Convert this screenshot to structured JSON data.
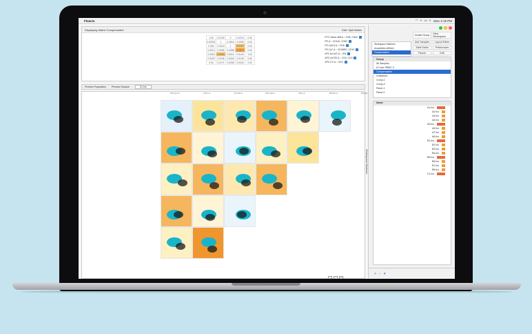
{
  "menubar": {
    "app_name": "FlowJo",
    "clock": "Mon 4:19 PM"
  },
  "matrix_pane": {
    "title": "Displaying Matrix Compensated",
    "edit_label": "Edit: Spill Matrix",
    "rows": [
      [
        "1.00",
        "0.0125",
        "0",
        "0.0219",
        "0.00"
      ],
      [
        "0.00321",
        "1",
        "0.0016",
        "0.0035",
        "0.00"
      ],
      [
        "0.002",
        "0.0215",
        "1",
        "0.0127",
        "0.00"
      ],
      [
        "0.0213",
        "0.0056",
        "0.0058",
        "1",
        "0.00"
      ],
      [
        "0.0024",
        "0.0094",
        "0.0011",
        "0.0143",
        "1.00"
      ],
      [
        "0.0020",
        "0.0048",
        "0.0003",
        "0.0125",
        "0.00"
      ],
      [
        "0.00",
        "0.0171",
        "0.0008",
        "0.0042",
        "0.00"
      ]
    ],
    "channels": [
      "FITC Alexa 488-A :: CD8, CD62",
      "PE-A :: CD11b, CD80",
      "PE-Cy5.5-A :: CD8",
      "PE-Cy7-A :: CD45RO, CD19",
      "APC Ax-647-A :: IFN",
      "APC-Ax700-A :: CD4, CD3",
      "APC-H7-A :: CD3"
    ]
  },
  "preview": {
    "label": "Preview Population",
    "sample_label": "Preview Sample",
    "sample_value": "A1.fcs"
  },
  "grid": {
    "headers": [
      "PE-Cy7-A",
      "FITC-A",
      "PerCP-A",
      "PE-Cy5-A",
      "APC-A",
      "BV421-A",
      "BV510-A",
      "BV605-A"
    ]
  },
  "vertical_label": "Workspace Matrices",
  "right_panel": {
    "nav_items": [
      "Workspace Matrices",
      "Acquisition-defined",
      "Compensation"
    ],
    "toolbar": [
      "Create Group",
      "New Workspace",
      "Add Samples",
      "Layout Editor",
      "Table Editor",
      "Preferences",
      "FlowJo",
      "Edit"
    ],
    "groups": {
      "header": "Group",
      "items": [
        "All Samples",
        "8 Color PBMC-2",
        "Compensation",
        "Unstained",
        "Comp-1",
        "Comp-2",
        "Panel-1",
        "Panel-2"
      ]
    },
    "samples": {
      "header": "Name",
      "items": [
        "A1.fcs",
        "A2.fcs",
        "A3.fcs",
        "A4.fcs",
        "A5.fcs",
        "A6.fcs",
        "A7.fcs",
        "A8.fcs",
        "B1.fcs",
        "B2.fcs",
        "B3.fcs",
        "B4.fcs",
        "B5.fcs",
        "B6.fcs",
        "B7.fcs",
        "B8.fcs",
        "C1.fcs"
      ]
    }
  },
  "colors": {
    "accent": "#2a6cd0",
    "highlight": "#f6c56f",
    "strong": "#f09a3a",
    "population": "#1ab4c9"
  }
}
